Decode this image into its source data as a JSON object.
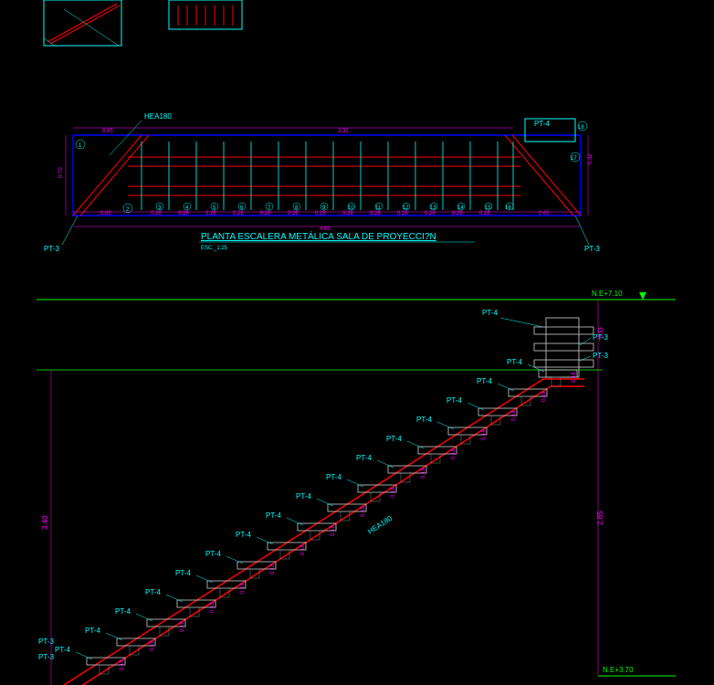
{
  "plan_view": {
    "title": "PLANTA ESCALERA METÁLICA SALA DE PROYECCI?N",
    "scale": "ESC._1:25",
    "beam_label": "HEA180",
    "top_left_label": "PT-4",
    "bottom_left_label": "PT-3",
    "bottom_right_label": "PT-3",
    "dim_left": "0.85",
    "dim_top_span": "3.32",
    "dim_vert": "0.70",
    "dim_vert_right": "0.32",
    "dim_total_bottom": "4.62",
    "step_dim": "0.26",
    "side_dim": "0.65",
    "circled_top_left": "1",
    "circled_top_right": "18",
    "circled_mid_right": "17",
    "circled_bottom_left": "2",
    "circled_3": "3",
    "circled_4": "4",
    "circled_5": "5",
    "circled_6": "6",
    "circled_7": "7",
    "circled_8": "8",
    "circled_9": "9",
    "circled_10": "10",
    "circled_11": "11",
    "circled_12": "12",
    "circled_13": "13",
    "circled_14": "14",
    "circled_15": "15",
    "circled_16": "16"
  },
  "elevation_view": {
    "level_top": "N.E+7.10",
    "level_bottom": "N.E+3.70",
    "dim_left_height": "3.40",
    "dim_right_height": "2.85",
    "dim_top_right": "0.35",
    "beam_label": "HEA180",
    "pt4_label": "PT-4",
    "pt3_label": "PT-3",
    "step_riser": "0.18",
    "step_tread": "0.184"
  }
}
